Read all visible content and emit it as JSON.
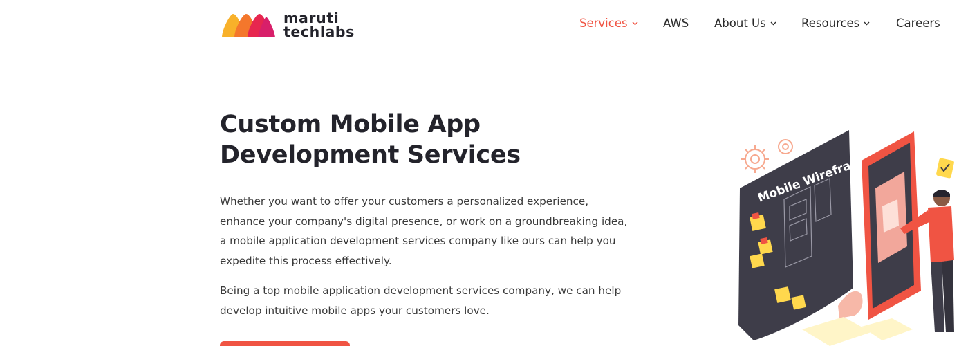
{
  "brand": {
    "line1": "maruti",
    "line2": "techlabs",
    "logo_icon": "maruti-techlabs-logo-icon"
  },
  "nav": {
    "services": "Services",
    "aws": "AWS",
    "about": "About Us",
    "resources": "Resources",
    "careers": "Careers"
  },
  "hero": {
    "title_line1": "Custom Mobile App",
    "title_line2": "Development Services",
    "paragraph1": "Whether you want to offer your customers a personalized experience, enhance your company's digital presence, or work on a groundbreaking idea, a mobile application development services company like ours can help you expedite this process effectively.",
    "paragraph2": "Being a top mobile application development services company, we can help develop intuitive mobile apps your customers love.",
    "illustration_label": "Mobile Wireframe"
  },
  "colors": {
    "accent": "#f05443",
    "text": "#23232b"
  }
}
